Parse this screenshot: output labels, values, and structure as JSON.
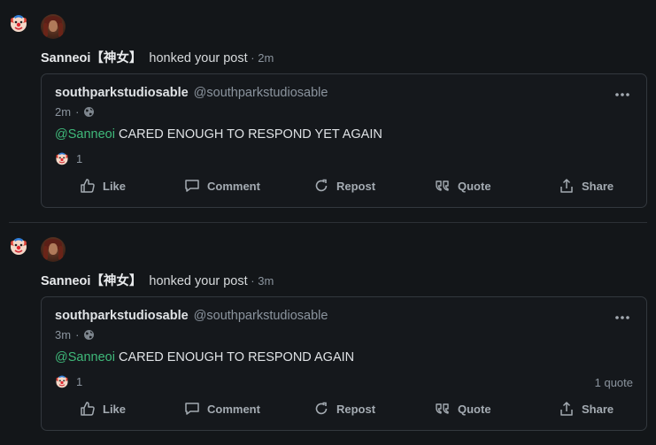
{
  "notifications": [
    {
      "icon": "clown-honk-icon",
      "actor": "Sanneoi【神女】",
      "action": "honked your post",
      "time": " · 2m",
      "post": {
        "author": "southparkstudiosable",
        "handle": "@southparkstudiosable",
        "time": "2m",
        "visibility_icon": "globe-icon",
        "mention": "@Sanneoi",
        "text": " CARED ENOUGH TO RESPOND YET AGAIN",
        "reaction_count": "1",
        "quote_count": "",
        "actions": {
          "like": "Like",
          "comment": "Comment",
          "repost": "Repost",
          "quote": "Quote",
          "share": "Share"
        }
      }
    },
    {
      "icon": "clown-honk-icon",
      "actor": "Sanneoi【神女】",
      "action": "honked your post",
      "time": " · 3m",
      "post": {
        "author": "southparkstudiosable",
        "handle": "@southparkstudiosable",
        "time": "3m",
        "visibility_icon": "globe-icon",
        "mention": "@Sanneoi",
        "text": " CARED ENOUGH TO RESPOND AGAIN",
        "reaction_count": "1",
        "quote_count": "1 quote",
        "actions": {
          "like": "Like",
          "comment": "Comment",
          "repost": "Repost",
          "quote": "Quote",
          "share": "Share"
        }
      }
    }
  ],
  "colors": {
    "background": "#131619",
    "card": "#15181c",
    "border": "#33383e",
    "mention": "#3fb97a",
    "muted": "#8b949e"
  }
}
